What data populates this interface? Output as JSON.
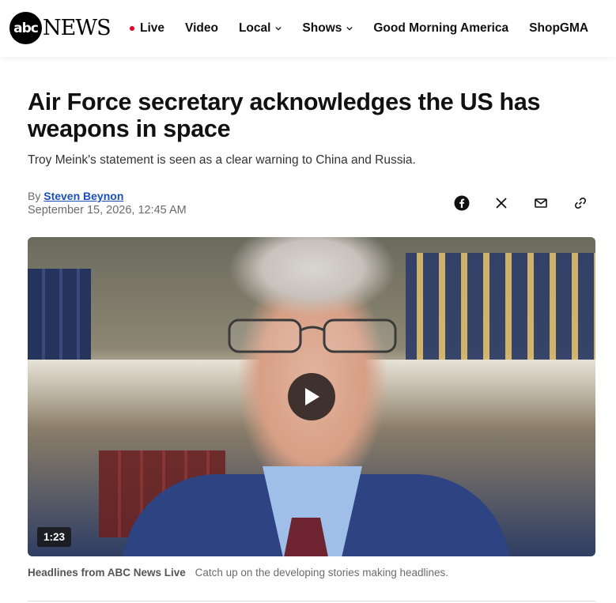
{
  "brand": {
    "logo_circle_text": "abc",
    "logo_news_text": "NEWS"
  },
  "nav": {
    "items": [
      {
        "label": "Live",
        "has_dot": true,
        "dropdown": false
      },
      {
        "label": "Video",
        "dropdown": false
      },
      {
        "label": "Local",
        "dropdown": true
      },
      {
        "label": "Shows",
        "dropdown": true
      },
      {
        "label": "Good Morning America",
        "dropdown": false
      },
      {
        "label": "ShopGMA",
        "dropdown": false
      }
    ]
  },
  "article": {
    "headline": "Air Force secretary acknowledges the US has weapons in space",
    "dek": "Troy Meink's statement is seen as a clear warning to China and Russia.",
    "byline_prefix": "By",
    "author": "Steven Beynon",
    "date": "September 15, 2026, 12:45 AM"
  },
  "share": {
    "icons": [
      "facebook-icon",
      "x-icon",
      "mail-icon",
      "link-icon"
    ]
  },
  "video": {
    "duration": "1:23",
    "caption_source": "Headlines from ABC News Live",
    "caption_text": "Catch up on the developing stories making headlines."
  },
  "colors": {
    "accent_red": "#e4002b",
    "author_link": "#1a4fba"
  }
}
